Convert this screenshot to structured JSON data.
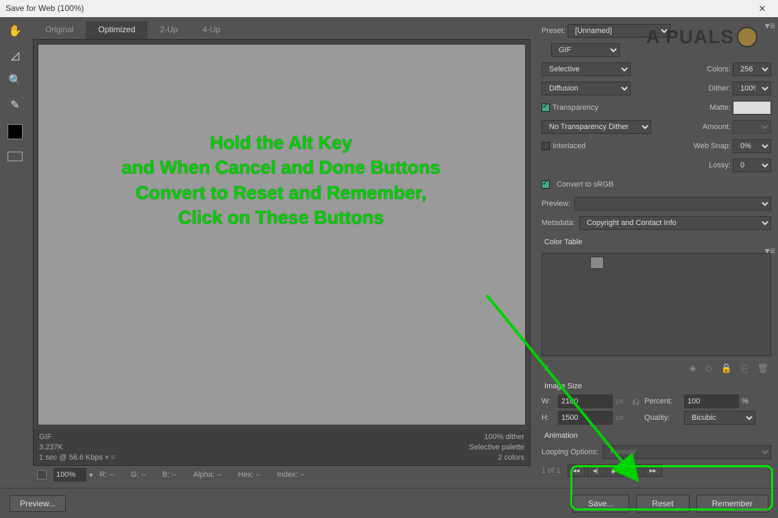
{
  "window": {
    "title": "Save for Web (100%)"
  },
  "tabs": {
    "original": "Original",
    "optimized": "Optimized",
    "twoup": "2-Up",
    "fourup": "4-Up"
  },
  "info": {
    "format": "GIF",
    "size": "3.237K",
    "speed": "1 sec @ 56.6 Kbps",
    "dither": "100% dither",
    "palette": "Selective palette",
    "colors": "2 colors"
  },
  "status": {
    "zoom": "100%",
    "r": "R: --",
    "g": "G: --",
    "b": "B: --",
    "alpha": "Alpha: --",
    "hex": "Hex: --",
    "index": "Index: --"
  },
  "preset": {
    "label": "Preset:",
    "value": "[Unnamed]",
    "format": "GIF",
    "reduction": "Selective",
    "colors_label": "Colors:",
    "colors": "256",
    "dither_method": "Diffusion",
    "dither_label": "Dither:",
    "dither_value": "100%",
    "transparency": "Transparency",
    "matte_label": "Matte:",
    "trans_dither": "No Transparency Dither",
    "amount_label": "Amount:",
    "interlaced": "Interlaced",
    "websnap_label": "Web Snap:",
    "websnap": "0%",
    "lossy_label": "Lossy:",
    "lossy": "0",
    "convert_srgb": "Convert to sRGB",
    "preview_label": "Preview:",
    "metadata_label": "Metadata:",
    "metadata": "Copyright and Contact Info"
  },
  "colortable": {
    "header": "Color Table",
    "count": "2"
  },
  "imagesize": {
    "header": "Image Size",
    "w_label": "W:",
    "w": "2100",
    "h_label": "H:",
    "h": "1500",
    "px": "px",
    "percent_label": "Percent:",
    "percent": "100",
    "pct_sym": "%",
    "quality_label": "Quality:",
    "quality": "Bicubic"
  },
  "animation": {
    "header": "Animation",
    "looping_label": "Looping Options:",
    "looping": "Forever",
    "page": "1 of 1"
  },
  "footer": {
    "preview": "Preview...",
    "save": "Save...",
    "reset": "Reset",
    "remember": "Remember"
  },
  "overlay": {
    "text": "Hold the Alt Key\nand When Cancel and Done Buttons\nConvert to Reset and Remember,\nClick on These Buttons"
  },
  "watermark": "wsxdn.com",
  "logo": "A  PUALS"
}
